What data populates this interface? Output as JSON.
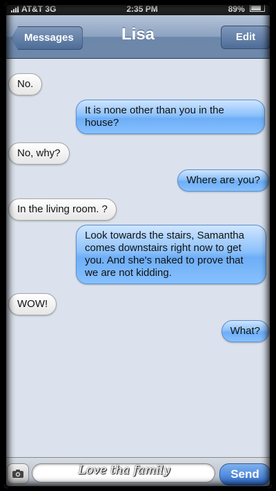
{
  "status_bar": {
    "carrier": "AT&T 3G",
    "time": "2:35 PM",
    "battery": "89%"
  },
  "nav": {
    "back_label": "Messages",
    "title": "Lisa",
    "edit_label": "Edit"
  },
  "messages": [
    {
      "direction": "in",
      "text": "No."
    },
    {
      "direction": "out",
      "text": "It is none other than you in the house?"
    },
    {
      "direction": "in",
      "text": "No, why?"
    },
    {
      "direction": "out",
      "text": "Where are you?"
    },
    {
      "direction": "in",
      "text": "In the living room. ?"
    },
    {
      "direction": "out",
      "text": "Look towards the stairs, Samantha comes downstairs right now to get you. And she's naked to prove that we are not kidding."
    },
    {
      "direction": "in",
      "text": "WOW!"
    },
    {
      "direction": "out",
      "text": "What?"
    }
  ],
  "composer": {
    "send_label": "Send",
    "camera_icon": "camera-icon"
  },
  "watermark": "Love tha family",
  "colors": {
    "incoming_bubble": "#ffffff",
    "outgoing_bubble": "#8cc1fb",
    "nav_bar": "#8ca2c0",
    "background": "#dbe2ed"
  }
}
